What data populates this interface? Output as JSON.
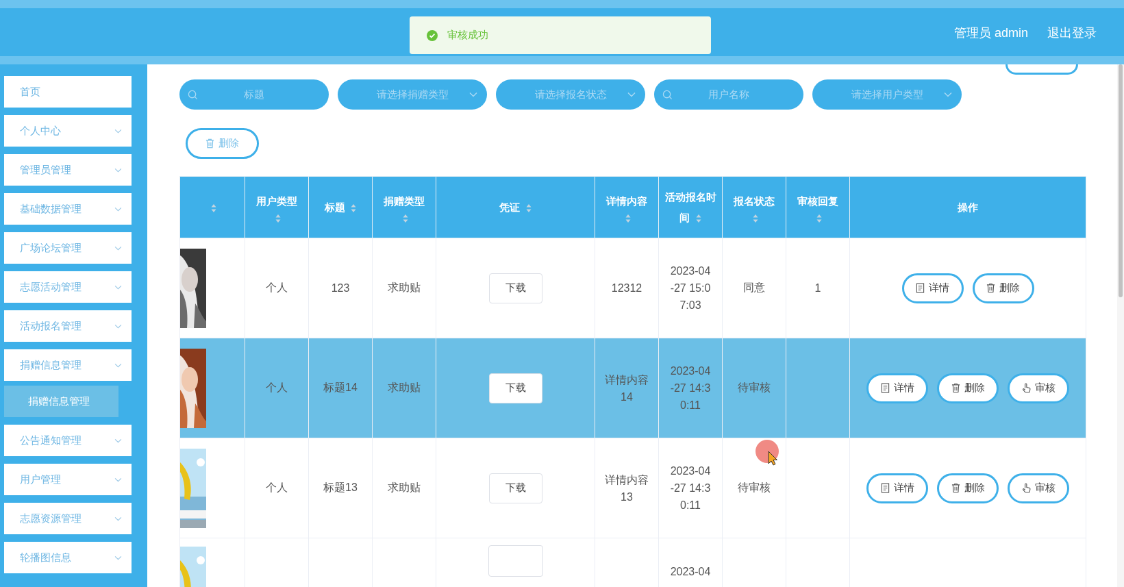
{
  "header": {
    "user": "管理员 admin",
    "logout": "退出登录"
  },
  "toast": {
    "message": "审核成功"
  },
  "sidebar": {
    "items": [
      {
        "label": "首页",
        "kind": "link"
      },
      {
        "label": "个人中心",
        "kind": "menu"
      },
      {
        "label": "管理员管理",
        "kind": "menu"
      },
      {
        "label": "基础数据管理",
        "kind": "menu"
      },
      {
        "label": "广场论坛管理",
        "kind": "menu"
      },
      {
        "label": "志愿活动管理",
        "kind": "menu"
      },
      {
        "label": "活动报名管理",
        "kind": "menu"
      },
      {
        "label": "捐赠信息管理",
        "kind": "menu",
        "children": [
          {
            "label": "捐赠信息管理",
            "selected": true
          }
        ]
      },
      {
        "label": "公告通知管理",
        "kind": "menu"
      },
      {
        "label": "用户管理",
        "kind": "menu"
      },
      {
        "label": "志愿资源管理",
        "kind": "menu"
      },
      {
        "label": "轮播图信息",
        "kind": "menu"
      }
    ]
  },
  "filters": [
    {
      "placeholder": "标题",
      "kind": "search"
    },
    {
      "placeholder": "请选择捐赠类型",
      "kind": "select"
    },
    {
      "placeholder": "请选择报名状态",
      "kind": "select"
    },
    {
      "placeholder": "用户名称",
      "kind": "search"
    },
    {
      "placeholder": "请选择用户类型",
      "kind": "select"
    }
  ],
  "delete_button": "删除",
  "table": {
    "columns": [
      {
        "sortable": true
      },
      {
        "label": "用户类型",
        "sortable": true
      },
      {
        "label": "标题",
        "sortable": true
      },
      {
        "label": "捐赠类型",
        "sortable": true
      },
      {
        "label": "凭证",
        "sortable": true
      },
      {
        "label": "详情内容",
        "sortable": true
      },
      {
        "label": "活动报名时间",
        "sortable": true
      },
      {
        "label": "报名状态",
        "sortable": true
      },
      {
        "label": "审核回复",
        "sortable": true
      },
      {
        "label": "操作",
        "sortable": false
      }
    ],
    "rows": [
      {
        "selected": false,
        "user_type": "个人",
        "title": "123",
        "donation_type": "求助贴",
        "proof": "下载",
        "details": "12312",
        "time": "2023-04-27 15:07:03",
        "status": "同意",
        "reply": "1",
        "actions": [
          {
            "label": "详情",
            "kind": "details"
          },
          {
            "label": "删除",
            "kind": "delete"
          }
        ]
      },
      {
        "selected": true,
        "user_type": "个人",
        "title": "标题14",
        "donation_type": "求助贴",
        "proof": "下载",
        "details": "详情内容14",
        "time": "2023-04-27 14:30:11",
        "status": "待审核",
        "actions": [
          {
            "label": "详情",
            "kind": "details"
          },
          {
            "label": "删除",
            "kind": "delete"
          },
          {
            "label": "审核",
            "kind": "review"
          }
        ]
      },
      {
        "selected": false,
        "user_type": "个人",
        "title": "标题13",
        "donation_type": "求助贴",
        "proof": "下载",
        "details": "详情内容13",
        "time": "2023-04-27 14:30:11",
        "status": "待审核",
        "actions": [
          {
            "label": "详情",
            "kind": "details"
          },
          {
            "label": "删除",
            "kind": "delete"
          },
          {
            "label": "审核",
            "kind": "review"
          }
        ]
      },
      {
        "selected": false,
        "time": "2023-04"
      }
    ]
  }
}
